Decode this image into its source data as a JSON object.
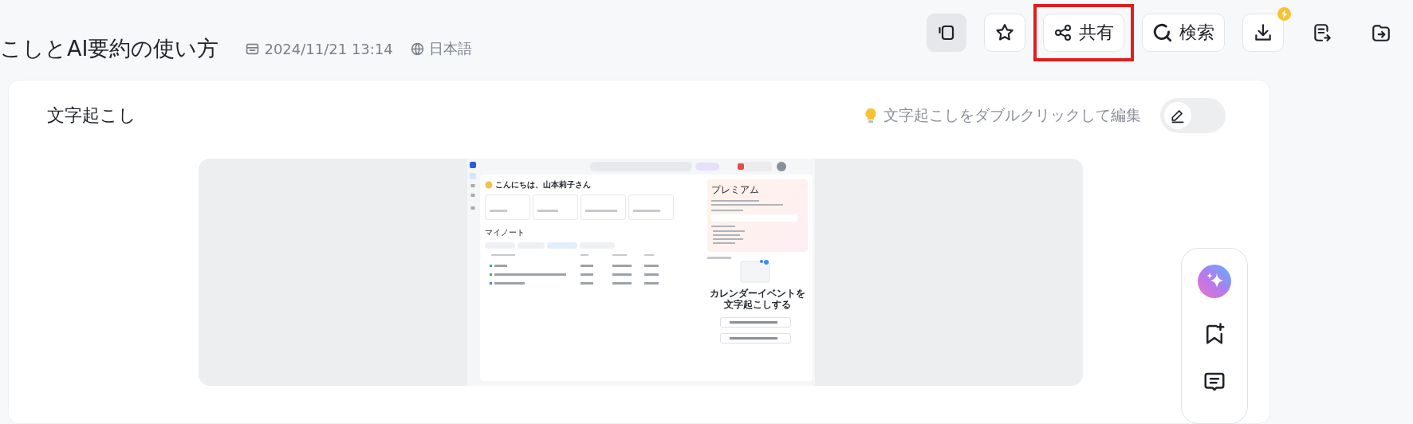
{
  "document": {
    "title": "こしとAI要約の使い方",
    "date": "2024/11/21 13:14",
    "language": "日本語"
  },
  "toolbar": [
    {
      "kind": "panel-toggle",
      "on": true
    },
    {
      "kind": "star",
      "on": false
    },
    {
      "kind": "share",
      "label": "共有",
      "on": false,
      "highlighted": true
    },
    {
      "kind": "search",
      "label": "検索",
      "on": false
    },
    {
      "kind": "download",
      "on": false,
      "badge": true
    },
    {
      "kind": "export",
      "on": false
    },
    {
      "kind": "move",
      "on": false
    }
  ],
  "transcript": {
    "heading": "文字起こし",
    "hint": "文字起こしをダブルクリックして編集",
    "edit_on": false
  },
  "embedded_screenshot": {
    "greeting": "こんにちは、山本莉子さん",
    "section": "マイノート",
    "premium": "プレミアム",
    "calendar_heading": "カレンダーイベントを文字起こしする"
  },
  "side_tools": [
    {
      "kind": "ai"
    },
    {
      "kind": "bookmark-add"
    },
    {
      "kind": "comment"
    }
  ]
}
